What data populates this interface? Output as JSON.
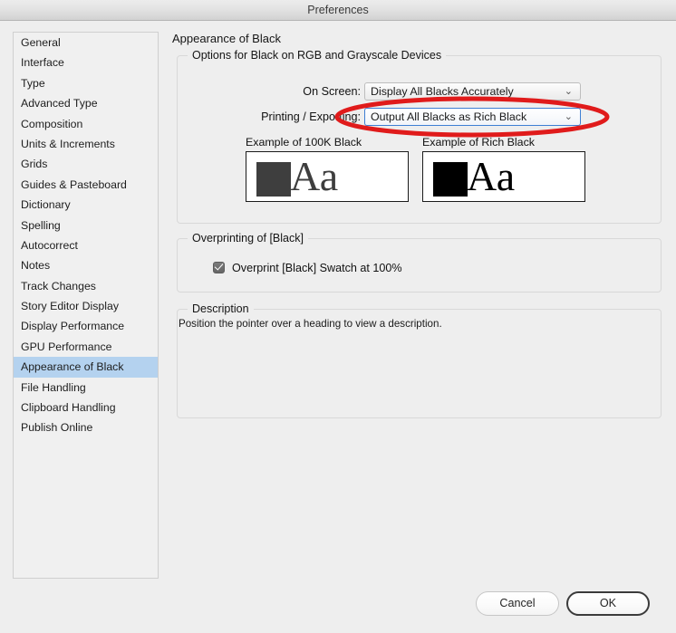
{
  "window": {
    "title": "Preferences"
  },
  "sidebar": {
    "items": [
      {
        "label": "General",
        "selected": false
      },
      {
        "label": "Interface",
        "selected": false
      },
      {
        "label": "Type",
        "selected": false
      },
      {
        "label": "Advanced Type",
        "selected": false
      },
      {
        "label": "Composition",
        "selected": false
      },
      {
        "label": "Units & Increments",
        "selected": false
      },
      {
        "label": "Grids",
        "selected": false
      },
      {
        "label": "Guides & Pasteboard",
        "selected": false
      },
      {
        "label": "Dictionary",
        "selected": false
      },
      {
        "label": "Spelling",
        "selected": false
      },
      {
        "label": "Autocorrect",
        "selected": false
      },
      {
        "label": "Notes",
        "selected": false
      },
      {
        "label": "Track Changes",
        "selected": false
      },
      {
        "label": "Story Editor Display",
        "selected": false
      },
      {
        "label": "Display Performance",
        "selected": false
      },
      {
        "label": "GPU Performance",
        "selected": false
      },
      {
        "label": "Appearance of Black",
        "selected": true
      },
      {
        "label": "File Handling",
        "selected": false
      },
      {
        "label": "Clipboard Handling",
        "selected": false
      },
      {
        "label": "Publish Online",
        "selected": false
      }
    ]
  },
  "main": {
    "pane_title": "Appearance of Black",
    "options_group": {
      "legend": "Options for Black on RGB and Grayscale Devices",
      "on_screen": {
        "label": "On Screen:",
        "value": "Display All Blacks Accurately",
        "chevron": "⌄"
      },
      "printing_exporting": {
        "label": "Printing / Exporting:",
        "value": "Output All Blacks as Rich Black",
        "chevron": "⌄",
        "focused": true
      },
      "examples": [
        {
          "label": "Example of 100K Black",
          "swatch_color": "#3e3e3e",
          "text_color": "#3e3e3e",
          "sample_text": "Aa"
        },
        {
          "label": "Example of Rich Black",
          "swatch_color": "#000000",
          "text_color": "#000000",
          "sample_text": "Aa"
        }
      ]
    },
    "overprinting_group": {
      "legend": "Overprinting of [Black]",
      "checkbox_label": "Overprint [Black] Swatch at 100%",
      "checked": true
    },
    "description_group": {
      "legend": "Description",
      "text": "Position the pointer over a heading to view a description."
    }
  },
  "footer": {
    "cancel_label": "Cancel",
    "ok_label": "OK"
  },
  "annotation": {
    "shape": "red-ellipse-highlight",
    "color": "#e01b1b",
    "targets": "printing-exporting-dropdown"
  },
  "colors": {
    "window_bg": "#eeeeee",
    "titlebar_top": "#ececec",
    "titlebar_bottom": "#d2d2d2",
    "sidebar_selection": "#b4d2ef",
    "focus_border": "#3e7fd4",
    "annotation_red": "#e01b1b"
  }
}
